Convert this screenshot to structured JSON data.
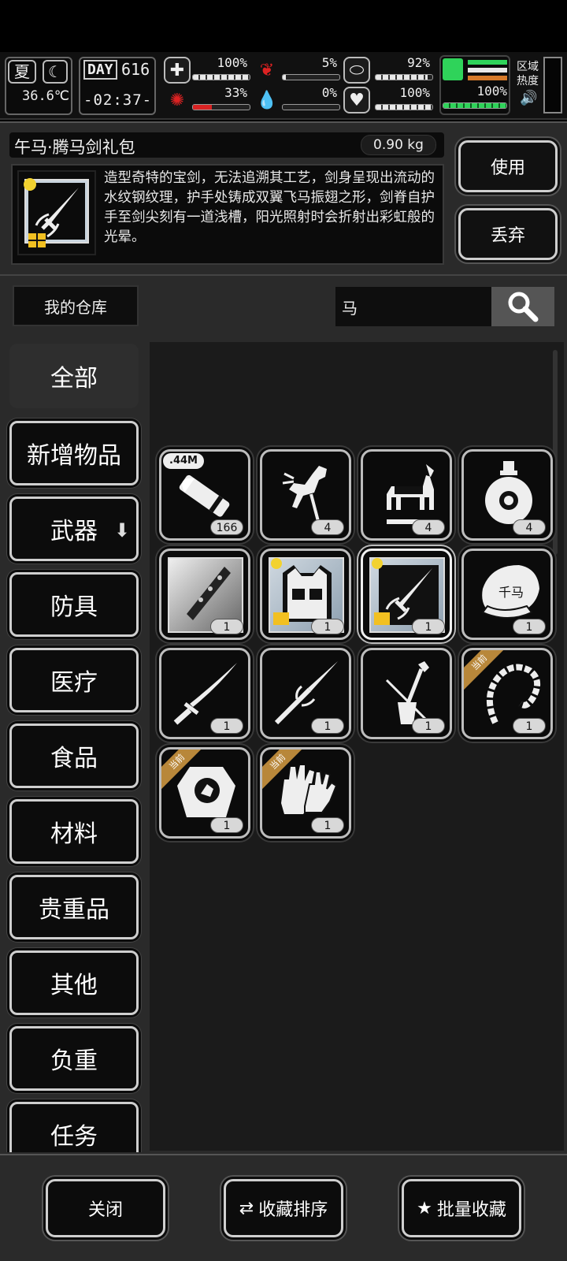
{
  "hud": {
    "season": "夏",
    "temperature": "36.6℃",
    "day_label": "DAY",
    "day": "616",
    "time": "-02:37-",
    "stats": [
      {
        "name": "health",
        "value": "100%",
        "fill": 1.0
      },
      {
        "name": "hunger",
        "value": "5%",
        "fill": 0.05
      },
      {
        "name": "stamina",
        "value": "92%",
        "fill": 0.92
      },
      {
        "name": "brain",
        "value": "33%",
        "fill": 0.33
      },
      {
        "name": "thirst",
        "value": "0%",
        "fill": 0.0
      },
      {
        "name": "mood",
        "value": "100%",
        "fill": 1.0
      }
    ],
    "load_value": "100%",
    "zone_heat_label": "区域热度"
  },
  "detail": {
    "name": "午马·腾马剑礼包",
    "weight": "0.90 kg",
    "description": "造型奇特的宝剑，无法追溯其工艺，剑身呈现出流动的水纹钢纹理，护手处铸成双翼飞马振翅之形，剑脊自护手至剑尖刻有一道浅槽，阳光照射时会折射出彩虹般的光晕。",
    "use_label": "使用",
    "drop_label": "丢弃"
  },
  "search": {
    "warehouse_label": "我的仓库",
    "query": "马"
  },
  "categories": [
    {
      "label": "全部"
    },
    {
      "label": "新增物品"
    },
    {
      "label": "武器"
    },
    {
      "label": "防具"
    },
    {
      "label": "医疗"
    },
    {
      "label": "食品"
    },
    {
      "label": "材料"
    },
    {
      "label": "贵重品"
    },
    {
      "label": "其他"
    },
    {
      "label": "负重"
    },
    {
      "label": "任务"
    }
  ],
  "items": [
    {
      "icon": "ammo-cartridge-icon",
      "count": "166",
      "tag": ".44M"
    },
    {
      "icon": "horse-statue-icon",
      "count": "4"
    },
    {
      "icon": "war-horse-icon",
      "count": "4"
    },
    {
      "icon": "wine-bottle-icon",
      "count": "4"
    },
    {
      "icon": "knuckle-weapon-icon",
      "count": "1"
    },
    {
      "icon": "vest-gift-icon",
      "count": "1"
    },
    {
      "icon": "sword-gift-icon",
      "count": "1"
    },
    {
      "icon": "horse-mask-icon",
      "count": "1"
    },
    {
      "icon": "katana-icon",
      "count": "1"
    },
    {
      "icon": "spear-icon",
      "count": "1"
    },
    {
      "icon": "horse-head-fiddle-icon",
      "count": "1"
    },
    {
      "icon": "whip-icon",
      "count": "1",
      "badge": "当前"
    },
    {
      "icon": "shield-emblem-icon",
      "count": "1",
      "badge": "当前"
    },
    {
      "icon": "gloves-icon",
      "count": "1",
      "badge": "当前"
    }
  ],
  "bottom": {
    "close_label": "关闭",
    "sort_label": "收藏排序",
    "batch_label": "批量收藏"
  }
}
